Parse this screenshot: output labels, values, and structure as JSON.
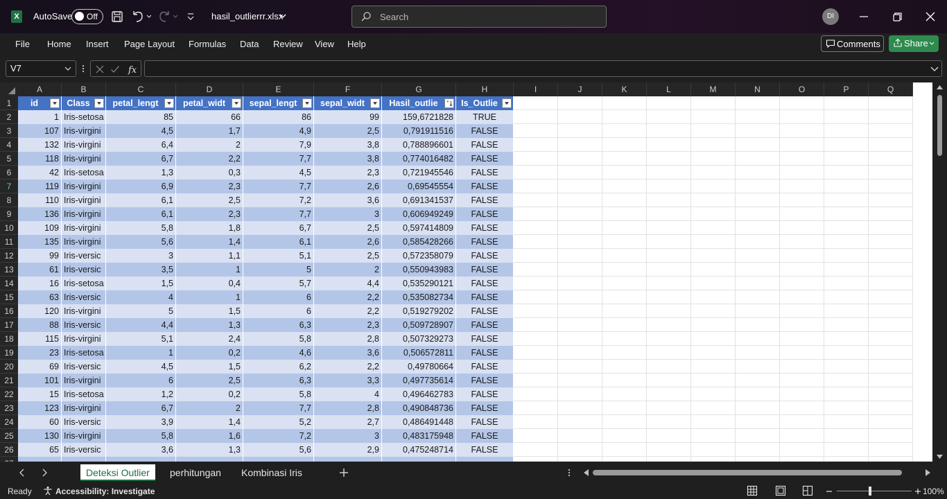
{
  "titlebar": {
    "autosave_label": "AutoSave",
    "autosave_state": "Off",
    "filename": "hasil_outlierrr.xlsx",
    "search_placeholder": "Search",
    "user_initials": "DI"
  },
  "menu": [
    "File",
    "Home",
    "Insert",
    "Page Layout",
    "Formulas",
    "Data",
    "Review",
    "View",
    "Help"
  ],
  "actions": {
    "comments": "Comments",
    "share": "Share"
  },
  "formula_bar": {
    "name_box": "V7",
    "formula": ""
  },
  "columns": [
    "A",
    "B",
    "C",
    "D",
    "E",
    "F",
    "G",
    "H",
    "I",
    "J",
    "K",
    "L",
    "M",
    "N",
    "O",
    "P",
    "Q"
  ],
  "table_headers": [
    "id",
    "Class",
    "petal_lengt",
    "petal_widt",
    "sepal_lengt",
    "sepal_widt",
    "Hasil_outlie",
    "Is_Outlie"
  ],
  "rows": [
    [
      "1",
      "Iris-setosa",
      "85",
      "66",
      "86",
      "99",
      "159,6721828",
      "TRUE"
    ],
    [
      "107",
      "Iris-virgini",
      "4,5",
      "1,7",
      "4,9",
      "2,5",
      "0,791911516",
      "FALSE"
    ],
    [
      "132",
      "Iris-virgini",
      "6,4",
      "2",
      "7,9",
      "3,8",
      "0,788896601",
      "FALSE"
    ],
    [
      "118",
      "Iris-virgini",
      "6,7",
      "2,2",
      "7,7",
      "3,8",
      "0,774016482",
      "FALSE"
    ],
    [
      "42",
      "Iris-setosa",
      "1,3",
      "0,3",
      "4,5",
      "2,3",
      "0,721945546",
      "FALSE"
    ],
    [
      "119",
      "Iris-virgini",
      "6,9",
      "2,3",
      "7,7",
      "2,6",
      "0,69545554",
      "FALSE"
    ],
    [
      "110",
      "Iris-virgini",
      "6,1",
      "2,5",
      "7,2",
      "3,6",
      "0,691341537",
      "FALSE"
    ],
    [
      "136",
      "Iris-virgini",
      "6,1",
      "2,3",
      "7,7",
      "3",
      "0,606949249",
      "FALSE"
    ],
    [
      "109",
      "Iris-virgini",
      "5,8",
      "1,8",
      "6,7",
      "2,5",
      "0,597414809",
      "FALSE"
    ],
    [
      "135",
      "Iris-virgini",
      "5,6",
      "1,4",
      "6,1",
      "2,6",
      "0,585428266",
      "FALSE"
    ],
    [
      "99",
      "Iris-versic",
      "3",
      "1,1",
      "5,1",
      "2,5",
      "0,572358079",
      "FALSE"
    ],
    [
      "61",
      "Iris-versic",
      "3,5",
      "1",
      "5",
      "2",
      "0,550943983",
      "FALSE"
    ],
    [
      "16",
      "Iris-setosa",
      "1,5",
      "0,4",
      "5,7",
      "4,4",
      "0,535290121",
      "FALSE"
    ],
    [
      "63",
      "Iris-versic",
      "4",
      "1",
      "6",
      "2,2",
      "0,535082734",
      "FALSE"
    ],
    [
      "120",
      "Iris-virgini",
      "5",
      "1,5",
      "6",
      "2,2",
      "0,519279202",
      "FALSE"
    ],
    [
      "88",
      "Iris-versic",
      "4,4",
      "1,3",
      "6,3",
      "2,3",
      "0,509728907",
      "FALSE"
    ],
    [
      "115",
      "Iris-virgini",
      "5,1",
      "2,4",
      "5,8",
      "2,8",
      "0,507329273",
      "FALSE"
    ],
    [
      "23",
      "Iris-setosa",
      "1",
      "0,2",
      "4,6",
      "3,6",
      "0,506572811",
      "FALSE"
    ],
    [
      "69",
      "Iris-versic",
      "4,5",
      "1,5",
      "6,2",
      "2,2",
      "0,49780664",
      "FALSE"
    ],
    [
      "101",
      "Iris-virgini",
      "6",
      "2,5",
      "6,3",
      "3,3",
      "0,497735614",
      "FALSE"
    ],
    [
      "15",
      "Iris-setosa",
      "1,2",
      "0,2",
      "5,8",
      "4",
      "0,496462783",
      "FALSE"
    ],
    [
      "123",
      "Iris-virgini",
      "6,7",
      "2",
      "7,7",
      "2,8",
      "0,490848736",
      "FALSE"
    ],
    [
      "60",
      "Iris-versic",
      "3,9",
      "1,4",
      "5,2",
      "2,7",
      "0,486491448",
      "FALSE"
    ],
    [
      "130",
      "Iris-virgini",
      "5,8",
      "1,6",
      "7,2",
      "3",
      "0,483175948",
      "FALSE"
    ],
    [
      "65",
      "Iris-versic",
      "3,6",
      "1,3",
      "5,6",
      "2,9",
      "0,475248714",
      "FALSE"
    ]
  ],
  "sheet_tabs": [
    "Deteksi Outlier",
    "perhitungan",
    "Kombinasi Iris"
  ],
  "status": {
    "ready": "Ready",
    "accessibility": "Accessibility: Investigate",
    "zoom": "100%"
  }
}
